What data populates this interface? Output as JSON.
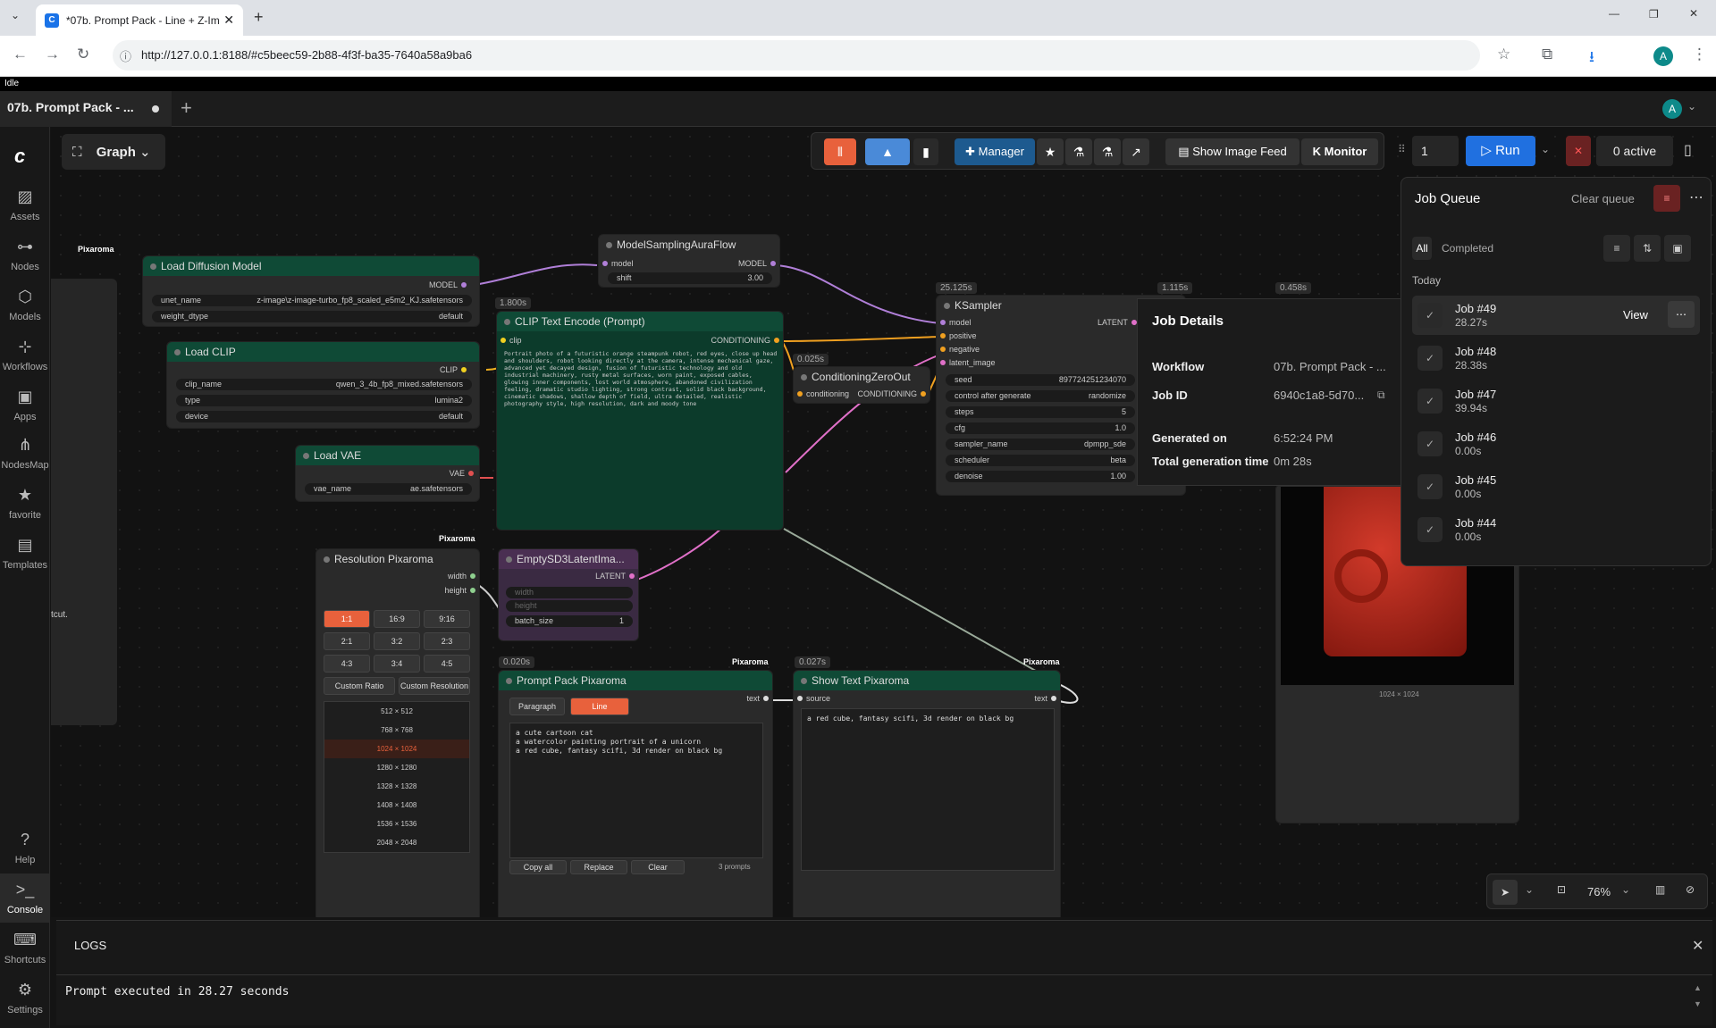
{
  "browser": {
    "tab_title": "*07b. Prompt Pack - Line + Z-Im",
    "url": "http://127.0.0.1:8188/#c5beec59-2b88-4f3f-ba35-7640a58a9ba6",
    "profile": "A"
  },
  "app": {
    "status": "Idle",
    "workflow_tab": "07b. Prompt Pack - ...",
    "graph_label": "Graph",
    "avatar": "A"
  },
  "sidebar": [
    {
      "label": "Assets",
      "icon": "image-icon"
    },
    {
      "label": "Nodes",
      "icon": "nodes-icon"
    },
    {
      "label": "Models",
      "icon": "models-icon"
    },
    {
      "label": "Workflows",
      "icon": "workflows-icon"
    },
    {
      "label": "Apps",
      "icon": "apps-icon"
    },
    {
      "label": "NodesMap",
      "icon": "map-icon"
    },
    {
      "label": "favorite",
      "icon": "star-icon"
    },
    {
      "label": "Templates",
      "icon": "templates-icon"
    },
    {
      "label": "Help",
      "icon": "help-icon"
    },
    {
      "label": "Console",
      "icon": "console-icon"
    },
    {
      "label": "Shortcuts",
      "icon": "keyboard-icon"
    },
    {
      "label": "Settings",
      "icon": "gear-icon"
    }
  ],
  "toolbar": {
    "manager": "Manager",
    "image_feed": "Show Image Feed",
    "monitor": "Monitor",
    "batch": "1",
    "run": "Run",
    "active": "0 active"
  },
  "nodes": {
    "load_diffusion": {
      "title": "Load Diffusion Model",
      "out": "MODEL",
      "unet_label": "unet_name",
      "unet": "z-image\\z-image-turbo_fp8_scaled_e5m2_KJ.safetensors",
      "dtype_label": "weight_dtype",
      "dtype": "default",
      "badge": "Pixaroma"
    },
    "load_clip": {
      "title": "Load CLIP",
      "out": "CLIP",
      "name_label": "clip_name",
      "name": "qwen_3_4b_fp8_mixed.safetensors",
      "type_label": "type",
      "type": "lumina2",
      "device_label": "device",
      "device": "default"
    },
    "load_vae": {
      "title": "Load VAE",
      "out": "VAE",
      "name_label": "vae_name",
      "name": "ae.safetensors"
    },
    "aura": {
      "title": "ModelSamplingAuraFlow",
      "in": "model",
      "out": "MODEL",
      "shift_label": "shift",
      "shift": "3.00"
    },
    "clip_encode": {
      "title": "CLIP Text Encode (Prompt)",
      "time": "1.800s",
      "in": "clip",
      "out": "CONDITIONING",
      "text": "Portrait photo of a futuristic orange steampunk robot, red eyes, close up head and shoulders, robot looking directly at the camera, intense mechanical gaze, advanced yet decayed design, fusion of futuristic technology and old industrial machinery, rusty metal surfaces, worn paint, exposed cables, glowing inner components, lost world atmosphere, abandoned civilization feeling, dramatic studio lighting, strong contrast, solid black background, cinematic shadows, shallow depth of field, ultra detailed, realistic photography style, high resolution, dark and moody tone"
    },
    "czero": {
      "title": "ConditioningZeroOut",
      "time": "0.025s",
      "in": "conditioning",
      "out": "CONDITIONING"
    },
    "ksampler": {
      "title": "KSampler",
      "time": "25.125s",
      "inputs": [
        "model",
        "positive",
        "negative",
        "latent_image"
      ],
      "out": "LATENT",
      "widgets": [
        {
          "k": "seed",
          "v": "897724251234070"
        },
        {
          "k": "control after generate",
          "v": "randomize"
        },
        {
          "k": "steps",
          "v": "5"
        },
        {
          "k": "cfg",
          "v": "1.0"
        },
        {
          "k": "sampler_name",
          "v": "dpmpp_sde"
        },
        {
          "k": "scheduler",
          "v": "beta"
        },
        {
          "k": "denoise",
          "v": "1.00"
        }
      ]
    },
    "t1": "1.115s",
    "t2": "0.458s",
    "resolution": {
      "title": "Resolution Pixaroma",
      "badge": "Pixaroma",
      "out1": "width",
      "out2": "height",
      "ratios": [
        "1:1",
        "16:9",
        "9:16",
        "2:1",
        "3:2",
        "2:3",
        "4:3",
        "3:4",
        "4:5"
      ],
      "custom_ratio": "Custom Ratio",
      "custom_res": "Custom Resolution",
      "sizes": [
        "512 × 512",
        "768 × 768",
        "1024 × 1024",
        "1280 × 1280",
        "1328 × 1328",
        "1408 × 1408",
        "1536 × 1536",
        "2048 × 2048"
      ]
    },
    "latent": {
      "title": "EmptySD3LatentIma...",
      "out": "LATENT",
      "w": "width",
      "h": "height",
      "batch_label": "batch_size",
      "batch": "1"
    },
    "prompt_pack": {
      "title": "Prompt Pack Pixaroma",
      "time": "0.020s",
      "badge": "Pixaroma",
      "out": "text",
      "tab1": "Paragraph",
      "tab2": "Line",
      "text": "a cute cartoon cat\na watercolor painting portrait of a unicorn\na red cube, fantasy scifi, 3d render on black bg",
      "copy": "Copy all",
      "replace": "Replace",
      "clear": "Clear",
      "count": "3 prompts"
    },
    "show_text": {
      "title": "Show Text Pixaroma",
      "time": "0.027s",
      "badge": "Pixaroma",
      "in": "source",
      "out": "text",
      "text": "a red cube, fantasy scifi, 3d render on black bg"
    },
    "left_cut": "tcut.",
    "image_size": "1024 × 1024"
  },
  "queue": {
    "title": "Job Queue",
    "clear": "Clear queue",
    "tab_all": "All",
    "tab_completed": "Completed",
    "today": "Today",
    "view": "View",
    "jobs": [
      {
        "name": "Job #49",
        "time": "28.27s"
      },
      {
        "name": "Job #48",
        "time": "28.38s"
      },
      {
        "name": "Job #47",
        "time": "39.94s"
      },
      {
        "name": "Job #46",
        "time": "0.00s"
      },
      {
        "name": "Job #45",
        "time": "0.00s"
      },
      {
        "name": "Job #44",
        "time": "0.00s"
      }
    ]
  },
  "details": {
    "title": "Job Details",
    "workflow_label": "Workflow",
    "workflow": "07b. Prompt Pack - ...",
    "jobid_label": "Job ID",
    "jobid": "6940c1a8-5d70...",
    "gen_label": "Generated on",
    "gen": "6:52:24 PM",
    "total_label": "Total generation time",
    "total": "0m 28s"
  },
  "canvas_ctl": {
    "zoom": "76%"
  },
  "logs": {
    "title": "LOGS",
    "line": "Prompt executed in 28.27 seconds"
  }
}
